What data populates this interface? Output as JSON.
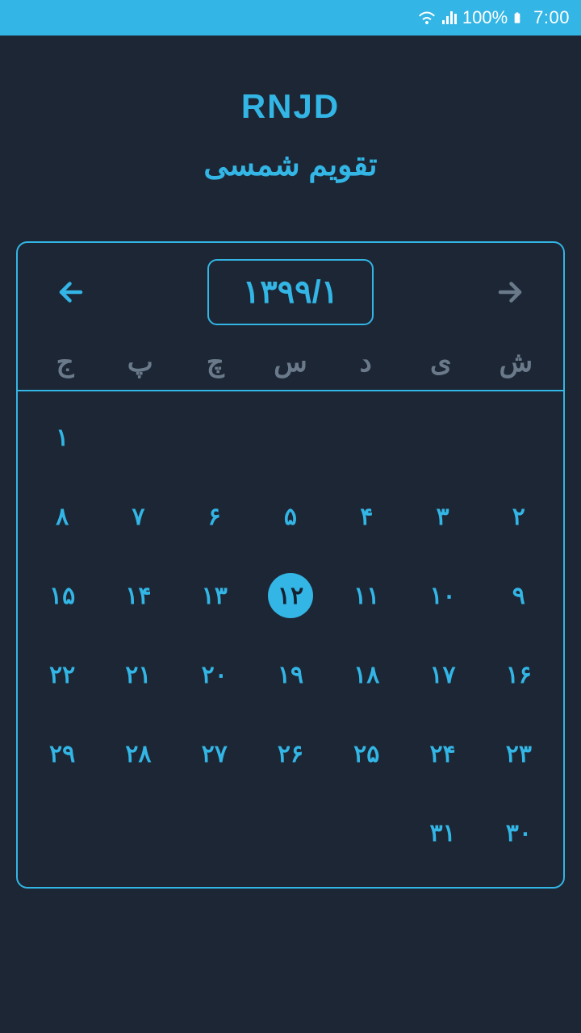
{
  "status": {
    "battery": "100%",
    "time": "7:00"
  },
  "header": {
    "title": "RNJD",
    "subtitle": "تقویم شمسی"
  },
  "calendar": {
    "month_label": "۱۳۹۹/۱",
    "selected_day_index": 17,
    "weekdays": [
      "ج",
      "پ",
      "چ",
      "س",
      "د",
      "ی",
      "ش"
    ],
    "days": [
      "۱",
      "",
      "",
      "",
      "",
      "",
      "",
      "۸",
      "۷",
      "۶",
      "۵",
      "۴",
      "۳",
      "۲",
      "۱۵",
      "۱۴",
      "۱۳",
      "۱۲",
      "۱۱",
      "۱۰",
      "۹",
      "۲۲",
      "۲۱",
      "۲۰",
      "۱۹",
      "۱۸",
      "۱۷",
      "۱۶",
      "۲۹",
      "۲۸",
      "۲۷",
      "۲۶",
      "۲۵",
      "۲۴",
      "۲۳",
      "",
      "",
      "",
      "",
      "",
      "۳۱",
      "۳۰"
    ]
  },
  "colors": {
    "accent": "#33B5E5",
    "bg": "#1C2634",
    "muted": "#6B7A8A"
  }
}
